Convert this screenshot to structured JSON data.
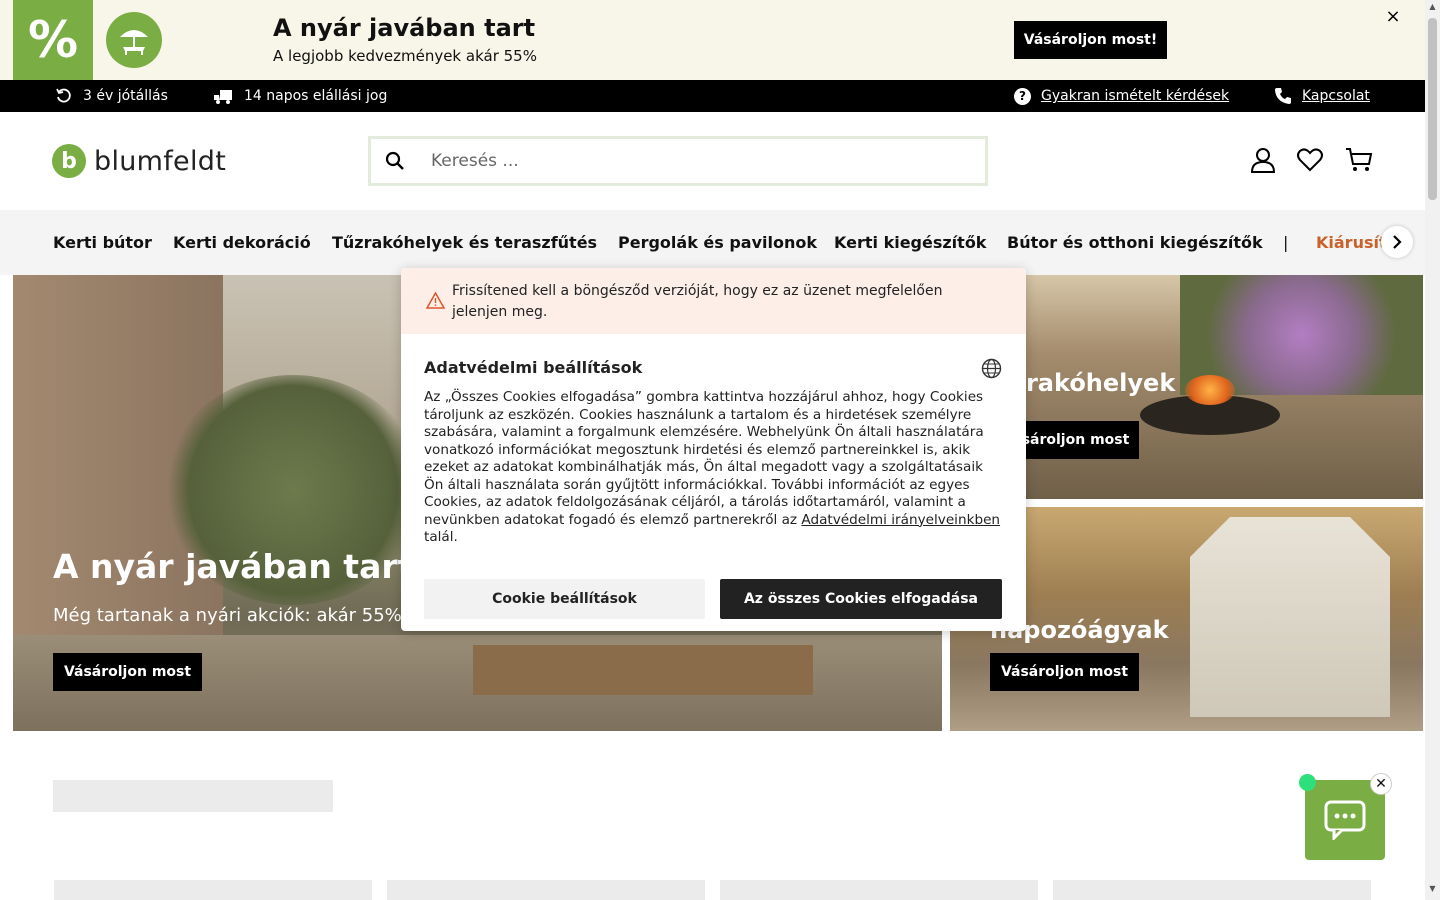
{
  "promo": {
    "percent_symbol": "%",
    "title": "A nyár javában tart",
    "subtitle": "A legjobb kedvezmények akár 55%",
    "cta": "Vásároljon most!",
    "close": "×"
  },
  "infobar": {
    "warranty": "3 év jótállás",
    "return": "14 napos elállási jog",
    "faq": "Gyakran ismételt kérdések",
    "contact": "Kapcsolat"
  },
  "header": {
    "logo_text": "blumfeldt",
    "logo_letter": "b",
    "search_placeholder": "Keresés ..."
  },
  "nav": {
    "items": [
      "Kerti bútor",
      "Kerti dekoráció",
      "Tűzrakóhelyek és teraszfűtés",
      "Pergolák és pavilonok",
      "Kerti kiegészítők",
      "Bútor és otthoni kiegészítők"
    ],
    "separator": "|",
    "sale": "Kiárusít"
  },
  "hero": {
    "main_title": "A nyár javában tart",
    "main_sub": "Még tartanak a nyári akciók: akár 55%",
    "main_cta": "Vásároljon most",
    "tr_title": "zrakóhelyek",
    "tr_cta": "sároljon most",
    "br_title": "rti napozóágyak",
    "br_cta": "Vásároljon most"
  },
  "cookie": {
    "warning": "Frissítened kell a böngésződ verzióját, hogy ez az üzenet megfelelően jelenjen meg.",
    "title": "Adatvédelmi beállítások",
    "body": "Az „Összes Cookies elfogadása” gombra kattintva hozzájárul ahhoz, hogy Cookies tároljunk az eszközén. Cookies használunk a tartalom és a hirdetések személyre szabására, valamint a forgalmunk elemzésére. Webhelyünk Ön általi használatára vonatkozó információkat megosztunk hirdetési és elemző partnereinkkel is, akik ezeket az adatokat kombinálhatják más, Ön által megadott vagy a szolgáltatásaik Ön általi használata során gyűjtött információkkal. További információt az egyes Cookies, az adatok feldolgozásának céljáról, a tárolás időtartamáról, valamint a nevünkben adatokat fogadó és elemző partnerekről az",
    "link": "Adatvédelmi irányelveinkben",
    "body_end": "talál.",
    "settings_btn": "Cookie beállítások",
    "accept_btn": "Az összes Cookies elfogadása"
  },
  "chat": {
    "close": "✕"
  },
  "colors": {
    "brand_green": "#7aad43",
    "sale_orange": "#c9622a",
    "black": "#000000"
  }
}
